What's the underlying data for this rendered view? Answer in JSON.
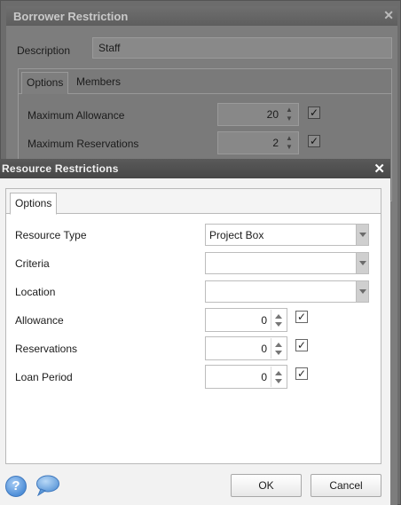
{
  "background_dialog": {
    "title": "Borrower Restriction",
    "close_glyph": "✕",
    "description_label": "Description",
    "description_value": "Staff",
    "tabs": [
      {
        "label": "Options",
        "active": true
      },
      {
        "label": "Members",
        "active": false
      }
    ],
    "rows": [
      {
        "label": "Maximum Allowance",
        "value": "20",
        "checked": true
      },
      {
        "label": "Maximum Reservations",
        "value": "2",
        "checked": true
      }
    ]
  },
  "dialog": {
    "title": "Resource Restrictions",
    "close_glyph": "✕",
    "tabs": [
      {
        "label": "Options",
        "active": true
      }
    ],
    "fields": {
      "resource_type": {
        "label": "Resource Type",
        "value": "Project Box"
      },
      "criteria": {
        "label": "Criteria",
        "value": ""
      },
      "location": {
        "label": "Location",
        "value": ""
      },
      "allowance": {
        "label": "Allowance",
        "value": "0",
        "checked": true
      },
      "reservations": {
        "label": "Reservations",
        "value": "0",
        "checked": true
      },
      "loan_period": {
        "label": "Loan Period",
        "value": "0",
        "checked": true
      }
    },
    "footer": {
      "help_glyph": "?",
      "ok_label": "OK",
      "cancel_label": "Cancel"
    }
  },
  "check_glyph": "✓",
  "icons": {
    "help": "help-icon",
    "chat": "chat-bubble-icon"
  },
  "colors": {
    "titlebar": "#4f4f4f",
    "dialog_bg": "#f2f2f2",
    "help_blue": "#4f8fd8"
  }
}
